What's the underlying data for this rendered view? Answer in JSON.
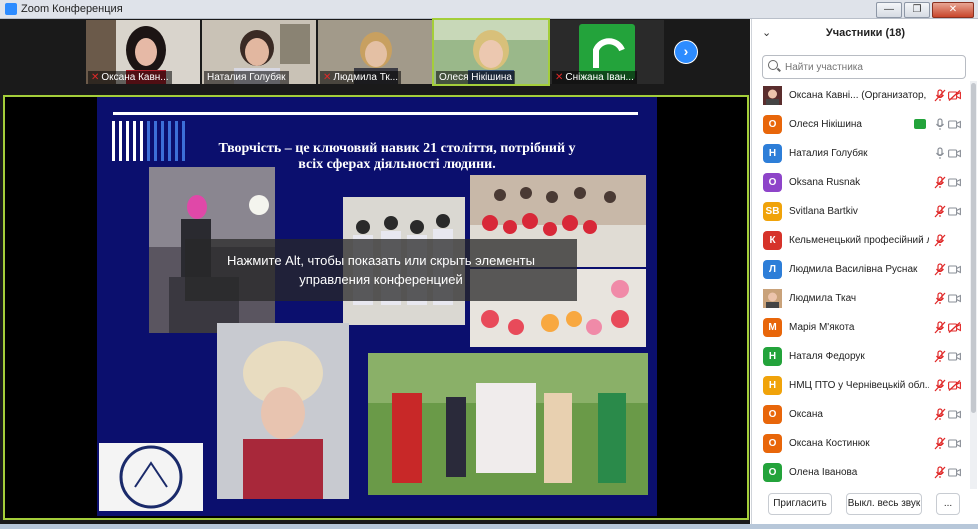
{
  "window": {
    "title": "Zoom Конференция",
    "min": "—",
    "max": "❐",
    "close": "✕"
  },
  "thumbnails": [
    {
      "name": "Оксана Кавн...",
      "muted": true,
      "active": false
    },
    {
      "name": "Наталия Голубяк",
      "muted": false,
      "active": false
    },
    {
      "name": "Людмила Тк...",
      "muted": true,
      "active": false
    },
    {
      "name": "Олеся Нікішина",
      "muted": false,
      "active": true
    },
    {
      "name": "Сніжана Іван...",
      "muted": true,
      "active": false
    }
  ],
  "next_icon": "›",
  "slide": {
    "heading_line1": "Творчість – це ключовий навик 21 століття, потрібний у",
    "heading_line2": "всіх сферах  діяльності людини."
  },
  "overlay": {
    "line1": "Нажмите Alt, чтобы показать или скрыть элементы",
    "line2": "управления конференцией"
  },
  "panel": {
    "chevron": "⌄",
    "title": "Участники (18)",
    "search_placeholder": "Найти участника",
    "participants": [
      {
        "name": "Оксана Кавні... (Организатор, я)",
        "initials": "",
        "color": "#5a2d2d",
        "photo": true,
        "mic": "off",
        "cam": "off"
      },
      {
        "name": "Олеся Нікішина",
        "initials": "О",
        "color": "#e8660a",
        "photo": false,
        "mic": "on",
        "cam": "on",
        "sharing": true
      },
      {
        "name": "Наталия Голубяк",
        "initials": "Н",
        "color": "#2d7ed8",
        "photo": false,
        "mic": "on",
        "cam": "on"
      },
      {
        "name": "Oksana Rusnak",
        "initials": "O",
        "color": "#8e44c9",
        "photo": false,
        "mic": "off",
        "cam": "on"
      },
      {
        "name": "Svitlana Bartkiv",
        "initials": "SB",
        "color": "#f0a30a",
        "photo": false,
        "mic": "off",
        "cam": "on"
      },
      {
        "name": "Кельменецький професійний ліцей",
        "initials": "К",
        "color": "#d6332a",
        "photo": false,
        "mic": "off",
        "cam": "none"
      },
      {
        "name": "Людмила Василівна Руснак",
        "initials": "Л",
        "color": "#2d7ed8",
        "photo": false,
        "mic": "off",
        "cam": "on"
      },
      {
        "name": "Людмила Ткач",
        "initials": "",
        "color": "#c9a27a",
        "photo": true,
        "mic": "off",
        "cam": "on"
      },
      {
        "name": "Марія М'якота",
        "initials": "М",
        "color": "#e8660a",
        "photo": false,
        "mic": "off",
        "cam": "off"
      },
      {
        "name": "Наталя Федорук",
        "initials": "Н",
        "color": "#23a33b",
        "photo": false,
        "mic": "off",
        "cam": "on"
      },
      {
        "name": "НМЦ ПТО у Чернівецькій обл...",
        "initials": "Н",
        "color": "#f0a30a",
        "photo": false,
        "mic": "off",
        "cam": "off"
      },
      {
        "name": "Оксана",
        "initials": "О",
        "color": "#e8660a",
        "photo": false,
        "mic": "off",
        "cam": "on"
      },
      {
        "name": "Оксана Костинюк",
        "initials": "О",
        "color": "#e8660a",
        "photo": false,
        "mic": "off",
        "cam": "on"
      },
      {
        "name": "Олена Іванова",
        "initials": "О",
        "color": "#23a33b",
        "photo": false,
        "mic": "off",
        "cam": "on"
      }
    ],
    "invite_label": "Пригласить",
    "mute_all_label": "Выкл. весь звук",
    "more_label": "..."
  }
}
